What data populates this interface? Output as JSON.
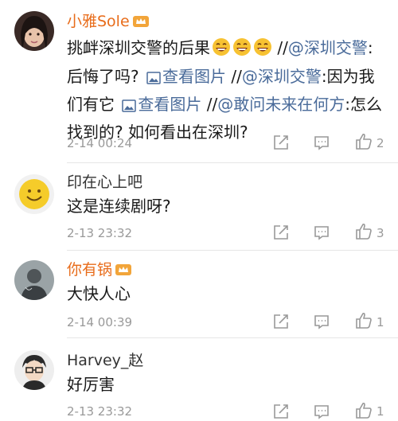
{
  "comments": [
    {
      "username": "小雅Sole",
      "text_prefix": "挑衅深圳交警的后果",
      "seg1": " //",
      "link1": "@深圳交警",
      "seg2": ": 后悔了吗? ",
      "pic1": "查看图片",
      "seg3": " //",
      "link2": "@深圳交警",
      "seg4": ":因为我们有它 ",
      "pic2": "查看图片",
      "seg5": " //",
      "link3": "@敢问未来在何方",
      "seg6": ":怎么找到的? 如何看出在深圳?",
      "time": "2-14 00:24",
      "likes": "2"
    },
    {
      "username": "印在心上吧",
      "text": "这是连续剧呀?",
      "time": "2-13 23:32",
      "likes": "3"
    },
    {
      "username": "你有锅",
      "text": "大快人心",
      "time": "2-14 00:39",
      "likes": "1"
    },
    {
      "username": "Harvey_赵",
      "text": "好厉害",
      "time": "2-13 23:32",
      "likes": "1"
    }
  ],
  "colors": {
    "vip_name": "#e86c1a",
    "link": "#4a6b9a",
    "meta": "#999999"
  }
}
